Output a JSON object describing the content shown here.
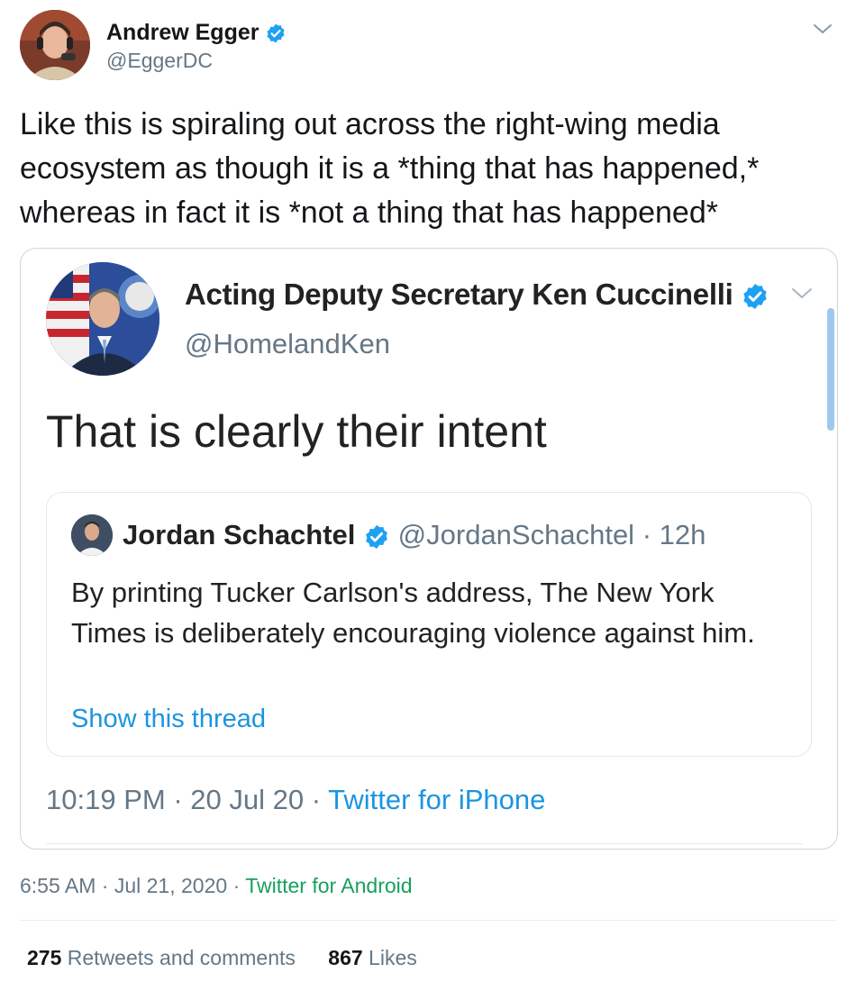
{
  "outer_tweet": {
    "author_name": "Andrew Egger",
    "author_handle": "@EggerDC",
    "text": "Like this is spiraling out across the right-wing media\necosystem as though it is a *thing that has happened,*\nwhereas in fact it is *not a thing that has happened*",
    "time": "6:55 AM",
    "date": "Jul 21, 2020",
    "source": "Twitter for Android",
    "retweets_count": "275",
    "retweets_label": "Retweets and comments",
    "likes_count": "867",
    "likes_label": "Likes"
  },
  "embedded_tweet": {
    "author_name": "Acting Deputy Secretary Ken Cuccinelli",
    "author_handle": "@HomelandKen",
    "text": "That is clearly their intent",
    "time": "10:19 PM",
    "date": "20 Jul 20",
    "source": "Twitter for iPhone"
  },
  "quoted_tweet": {
    "author_name": "Jordan Schachtel",
    "author_handle": "@JordanSchachtel",
    "age": "12h",
    "text": "By printing Tucker Carlson's address, The New York Times is deliberately encouraging violence against him.",
    "show_thread_label": "Show this thread"
  },
  "separators": {
    "dot": "·"
  },
  "colors": {
    "link_blue": "#1b95e0",
    "verified_blue": "#1da1f2",
    "android_green": "#17a05d",
    "secondary_text": "#657786"
  },
  "icons": [
    "avatar",
    "verified-badge-icon",
    "chevron-down-icon"
  ]
}
